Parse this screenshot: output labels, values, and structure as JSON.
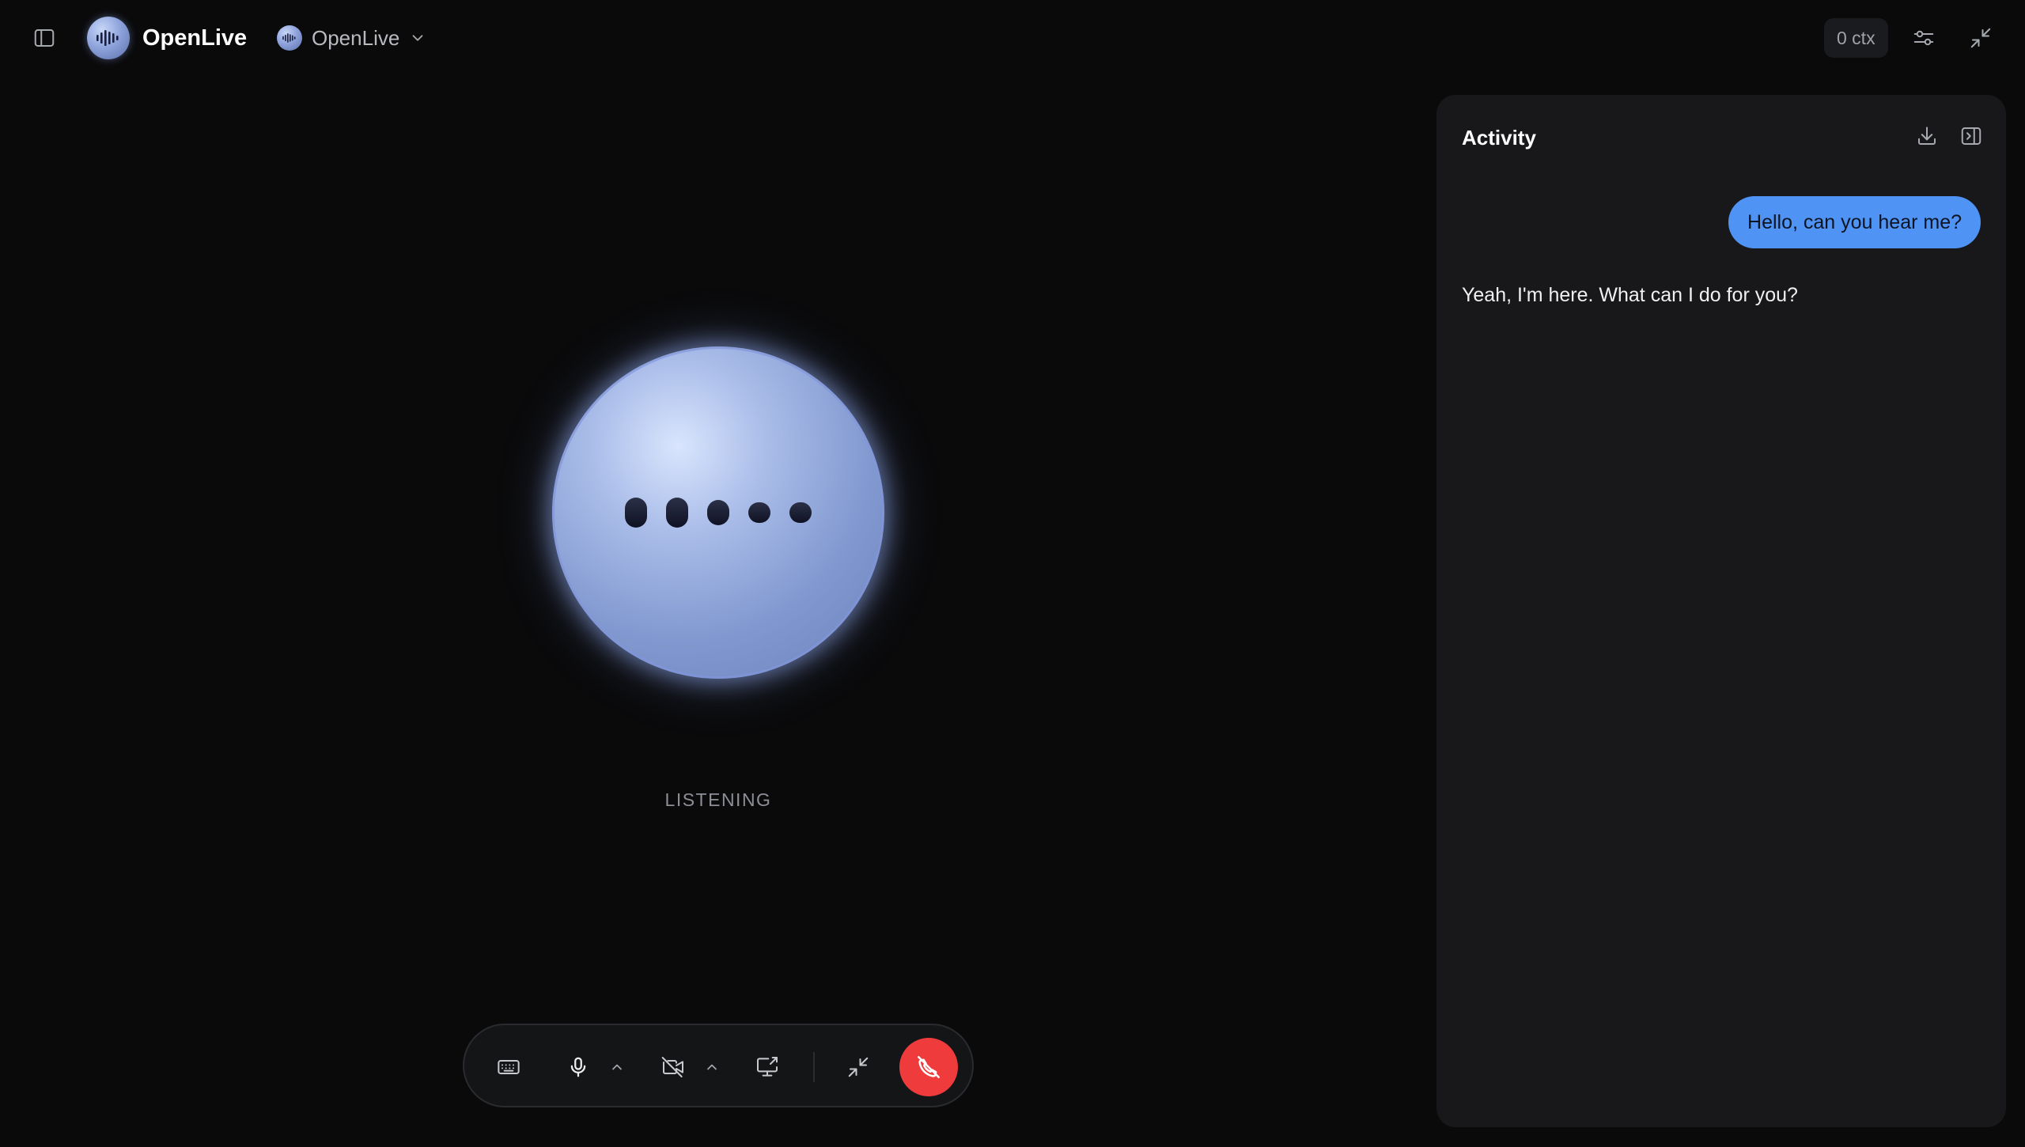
{
  "app": {
    "name": "OpenLive",
    "model_selector": {
      "label": "OpenLive"
    },
    "context_badge": "0 ctx"
  },
  "stage": {
    "status": "LISTENING",
    "orb_bars": [
      {
        "height": 38
      },
      {
        "height": 38
      },
      {
        "height": 32
      },
      {
        "height": 26
      },
      {
        "height": 26
      }
    ]
  },
  "controls": {
    "keyboard": "keyboard-icon",
    "mic": "mic-icon",
    "camera": "camera-off-icon",
    "screen_share": "screen-share-icon",
    "minimize": "minimize-icon",
    "end_call": "phone-hangup-icon"
  },
  "activity": {
    "title": "Activity",
    "messages": [
      {
        "role": "user",
        "text": "Hello, can you hear me?"
      },
      {
        "role": "assistant",
        "text": "Yeah, I'm here. What can I do for you?"
      }
    ]
  },
  "colors": {
    "background": "#0a0a0b",
    "panel": "#18181b",
    "accent": "#4f93f5",
    "end_call": "#ef3b3b",
    "orb": "#8299d0"
  }
}
